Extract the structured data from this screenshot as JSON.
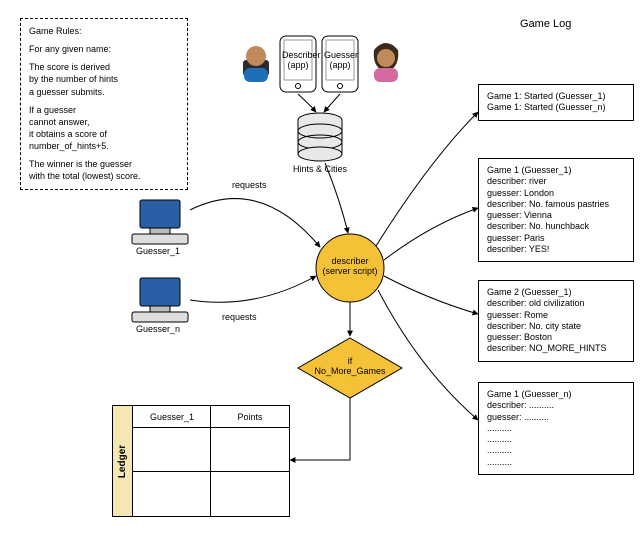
{
  "rules": {
    "title": "Game Rules:",
    "l1": "For any given name:",
    "l2a": "The score is derived",
    "l2b": "by the number of hints",
    "l2c": "a guesser submits.",
    "l3a": "If a guesser",
    "l3b": "cannot answer,",
    "l3c": "it obtains a score of",
    "l3d": "number_of_hints+5.",
    "l4a": "The winner is the guesser",
    "l4b": "with the total (lowest) score."
  },
  "headers": {
    "gamelog": "Game Log"
  },
  "apps": {
    "describer": "Describer\n(app)",
    "guesser": "Guesser\n(app)"
  },
  "labels": {
    "hints_cities": "Hints & Cities",
    "requests1": "requests",
    "requests2": "requests",
    "guesser1": "Guesser_1",
    "guessern": "Guesser_n",
    "describer_node": "describer\n(server script)",
    "decision": "if\nNo_More_Games",
    "ledger": "Ledger",
    "col_guesser": "Guesser_1",
    "col_points": "Points"
  },
  "log1": {
    "a": "Game 1: Started (Guesser_1)",
    "b": "Game 1: Started (Guesser_n)"
  },
  "log2": {
    "a": "Game 1 (Guesser_1)",
    "b": "describer: river",
    "c": "guesser: London",
    "d": "describer: No. famous pastries",
    "e": "guesser: Vienna",
    "f": "describer: No. hunchback",
    "g": "guesser: Paris",
    "h": "describer: YES!"
  },
  "log3": {
    "a": "Game 2 (Guesser_1)",
    "b": "describer: old civilization",
    "c": "guesser: Rome",
    "d": "describer: No. city state",
    "e": "guesser: Boston",
    "f": "describer: NO_MORE_HINTS"
  },
  "log4": {
    "a": "Game 1 (Guesser_n)",
    "b": "describer: ..........",
    "c": "guesser: ..........",
    "d": "..........",
    "e": "..........",
    "f": "..........",
    "g": ".........."
  }
}
